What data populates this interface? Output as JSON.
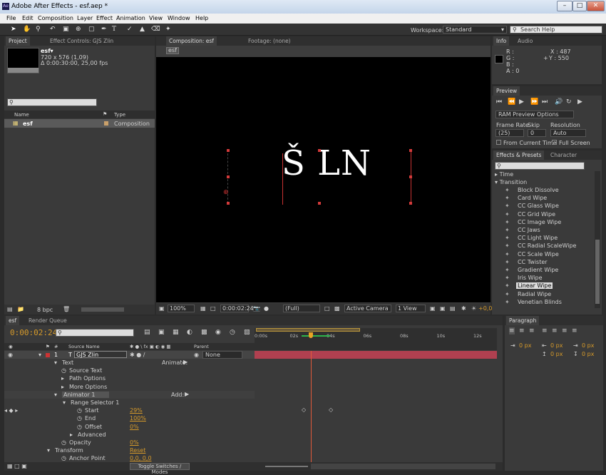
{
  "window": {
    "title": "Adobe After Effects - esf.aep *",
    "logo": "Ae"
  },
  "menu": [
    "File",
    "Edit",
    "Composition",
    "Layer",
    "Effect",
    "Animation",
    "View",
    "Window",
    "Help"
  ],
  "toolbar": {
    "workspace_label": "Workspace:",
    "workspace_value": "Standard",
    "search_placeholder": "Search Help"
  },
  "project": {
    "tab_project": "Project",
    "tab_effects": "Effect Controls: GJS Zlin",
    "comp_name": "esf▾",
    "comp_size": "720 x 576 (1,09)",
    "comp_dur": "Δ 0:00:30:00, 25,00 fps",
    "col_name": "Name",
    "col_type": "Type",
    "item_name": "esf",
    "item_type": "Composition",
    "bpc": "8 bpc"
  },
  "composition": {
    "tab": "Composition: esf",
    "footage_tab": "Footage: (none)",
    "crumb": "esf",
    "letters": "Š  LN",
    "zoom": "100%",
    "time": "0:00:02:24",
    "res": "(Full)",
    "camera": "Active Camera",
    "view": "1 View",
    "offset": "+0,0"
  },
  "info": {
    "tab": "Info",
    "tab2": "Audio",
    "r": "R :",
    "g": "G :",
    "b": "B :",
    "a": "A : 0",
    "x": "X : 487",
    "y": "Y : 550"
  },
  "preview": {
    "tab": "Preview",
    "options": "RAM Preview Options",
    "frame_rate_label": "Frame Rate",
    "skip_label": "Skip",
    "res_label": "Resolution",
    "frame_rate": "(25)",
    "skip": "0",
    "res": "Auto",
    "from_current": "From Current Time",
    "full_screen": "Full Screen"
  },
  "effects": {
    "tab": "Effects & Presets",
    "tab2": "Character",
    "cat_time": "Time",
    "cat_transition": "Transition",
    "items": [
      "Block Dissolve",
      "Card Wipe",
      "CC Glass Wipe",
      "CC Grid Wipe",
      "CC Image Wipe",
      "CC Jaws",
      "CC Light Wipe",
      "CC Radial ScaleWipe",
      "CC Scale Wipe",
      "CC Twister",
      "Gradient Wipe",
      "Iris Wipe",
      "Linear Wipe",
      "Radial Wipe",
      "Venetian Blinds"
    ],
    "selected_index": 12
  },
  "timeline": {
    "tab": "esf",
    "tab2": "Render Queue",
    "time": "0:00:02:24",
    "col_source": "Source Name",
    "col_parent": "Parent",
    "layer_num": "1",
    "layer_name": "GJS Zlin",
    "parent_value": "None",
    "ruler": [
      "0:00s",
      "02s",
      "04s",
      "06s",
      "08s",
      "10s",
      "12s"
    ],
    "rows": [
      {
        "label": "Text",
        "extra": "Animate:"
      },
      {
        "label": "Source Text"
      },
      {
        "label": "Path Options"
      },
      {
        "label": "More Options"
      },
      {
        "label": "Animator 1",
        "extra": "Add:"
      },
      {
        "label": "Range Selector 1"
      },
      {
        "label": "Start",
        "value": "29%"
      },
      {
        "label": "End",
        "value": "100%"
      },
      {
        "label": "Offset",
        "value": "0%"
      },
      {
        "label": "Advanced"
      },
      {
        "label": "Opacity",
        "value": "0%"
      },
      {
        "label": "Transform",
        "value": "Reset"
      },
      {
        "label": "Anchor Point",
        "value": "0,0, 0,0"
      }
    ],
    "toggle": "Toggle Switches / Modes"
  },
  "paragraph": {
    "tab": "Paragraph",
    "px": "0 px"
  }
}
